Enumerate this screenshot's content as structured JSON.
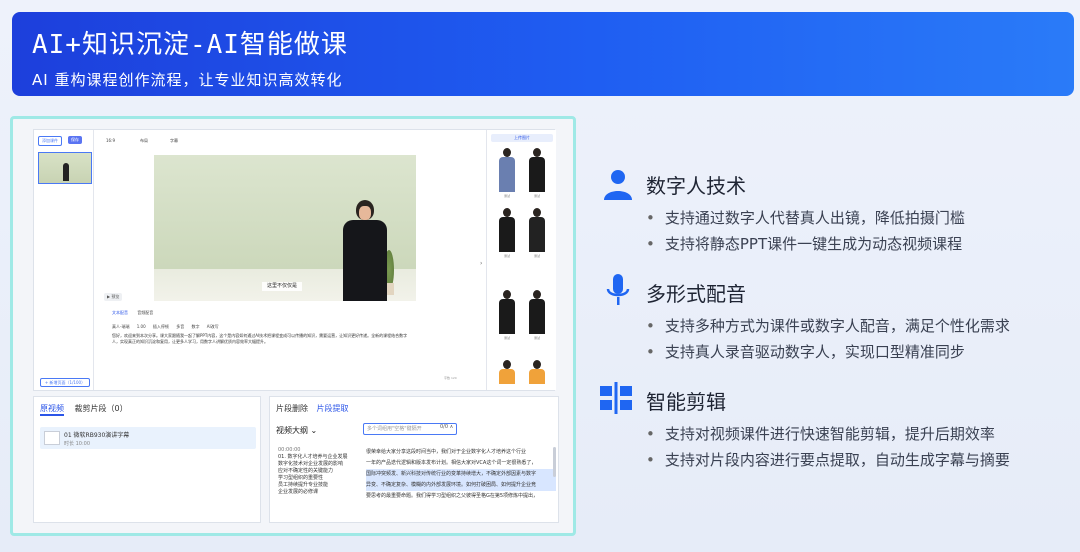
{
  "banner": {
    "title": "AI+知识沉淀-AI智能做课",
    "subtitle": "AI 重构课程创作流程，让专业知识高效转化"
  },
  "editor": {
    "add_button": "添加课件",
    "save_button": "保存",
    "slide_number": "1",
    "toolbar": [
      "16:9",
      "布局",
      "字幕"
    ],
    "caption": "这里不仅仅是",
    "play_label": "▶ 预览",
    "script_tabs": [
      "文本配音",
      "音频配音"
    ],
    "script_controls": [
      "真人-瑞瑞",
      "1.00",
      "插入停顿",
      "多音",
      "数字",
      "AI改写"
    ],
    "script_text": "您好，欢迎来到本次分享。课大家跟随我一起了解PPT内容，这个是内容如何通过AI技术把课程变成可以传播的知识，需要运营，让知识更好传递。全新的课程结合数字人，实现真正的知识沉淀和复用，让更多人学习，用数字人讲解优质内容效率大幅提升。",
    "char_count": "字数 120",
    "add_page_button": "+ 新增页面（1/100）",
    "upload_label": "上传图片",
    "avatar_labels": [
      "测试",
      "测试",
      "测试",
      "测试",
      "测试",
      "测试"
    ]
  },
  "bottom_left": {
    "tabs": [
      "原视频",
      "裁剪片段（0）"
    ],
    "clip_title": "01 微软RB930演讲字幕",
    "clip_time": "时长 10:00"
  },
  "bottom_right": {
    "tabs": [
      "片段删除",
      "片段提取"
    ],
    "outline_label": "视频大纲 ⌄",
    "search_placeholder": "多个词组用\"空格\"键隔开",
    "search_count": "0/0 ∧",
    "outline": [
      "00:00:00",
      "01. 数字化人才培养与企业发展",
      "数字化技术对企业发展的影响",
      "应对不确定性的关键能力",
      "学习型组织的重要性",
      "员工持续提升专业技能",
      "企业发展的必修课"
    ],
    "transcript": [
      "很荣幸给大家分享这段时间当中，我们对于企业数字化人才培养这个行业",
      "一年的产品迭代逻辑和版本发布计划。相信大家对VCA这个词一定很熟悉了，",
      "国际冲突频发、新兴科技对传统行业的变革持续增大，不确定外部因素与数字",
      "异变、不确定复杂、模糊的内外部发展环境。如何打破困局、如何提升企业竞",
      "要思考的最重要命题。我们得学习型组织之父彼得圣格G在第5项修炼中提出，"
    ]
  },
  "features": [
    {
      "title": "数字人技术",
      "icon": "person-icon",
      "bullets": [
        "支持通过数字人代替真人出镜，降低拍摄门槛",
        "支持将静态PPT课件一键生成为动态视频课程"
      ]
    },
    {
      "title": "多形式配音",
      "icon": "microphone-icon",
      "bullets": [
        "支持多种方式为课件或数字人配音，满足个性化需求",
        "支持真人录音驱动数字人，实现口型精准同步"
      ]
    },
    {
      "title": "智能剪辑",
      "icon": "scissor-edit-icon",
      "bullets": [
        "支持对视频课件进行快速智能剪辑，提升后期效率",
        "支持对片段内容进行要点提取，自动生成字幕与摘要"
      ]
    }
  ],
  "colors": {
    "banner_start": "#1d3fdc",
    "banner_end": "#2a7bf8",
    "accent": "#2b55e8",
    "icon": "#1f66f2",
    "frame_border": "#9fe9e6"
  }
}
